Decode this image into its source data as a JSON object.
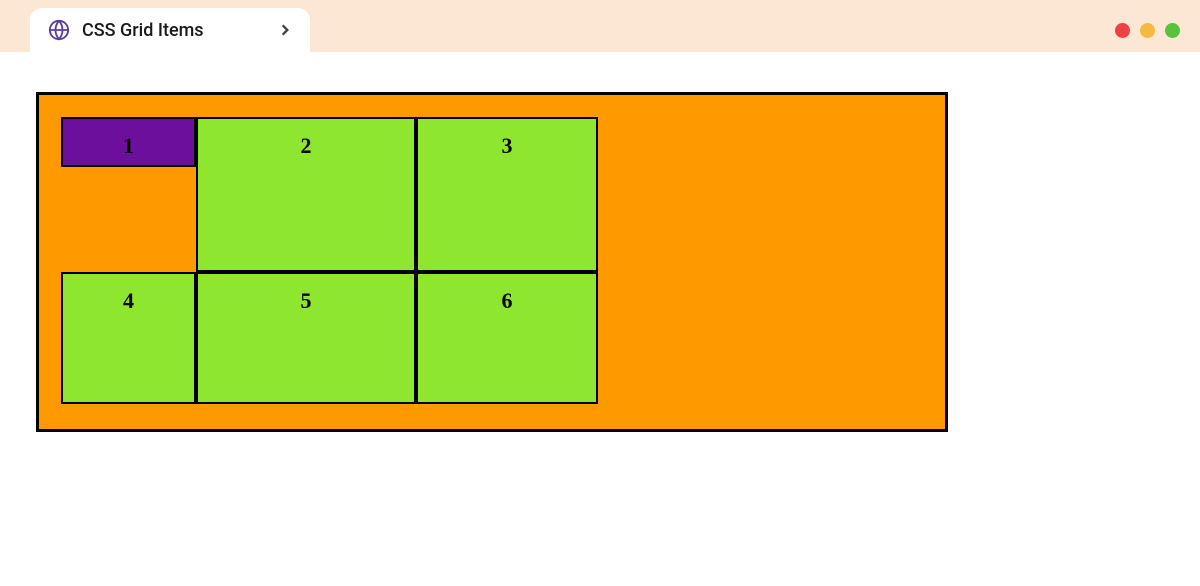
{
  "tab": {
    "title": "CSS Grid Items"
  },
  "grid": {
    "items": [
      {
        "label": "1"
      },
      {
        "label": "2"
      },
      {
        "label": "3"
      },
      {
        "label": "4"
      },
      {
        "label": "5"
      },
      {
        "label": "6"
      }
    ]
  },
  "colors": {
    "container_bg": "#ff9900",
    "item_bg": "#8fe62e",
    "item1_bg": "#6b0f9c",
    "border": "#000000"
  }
}
